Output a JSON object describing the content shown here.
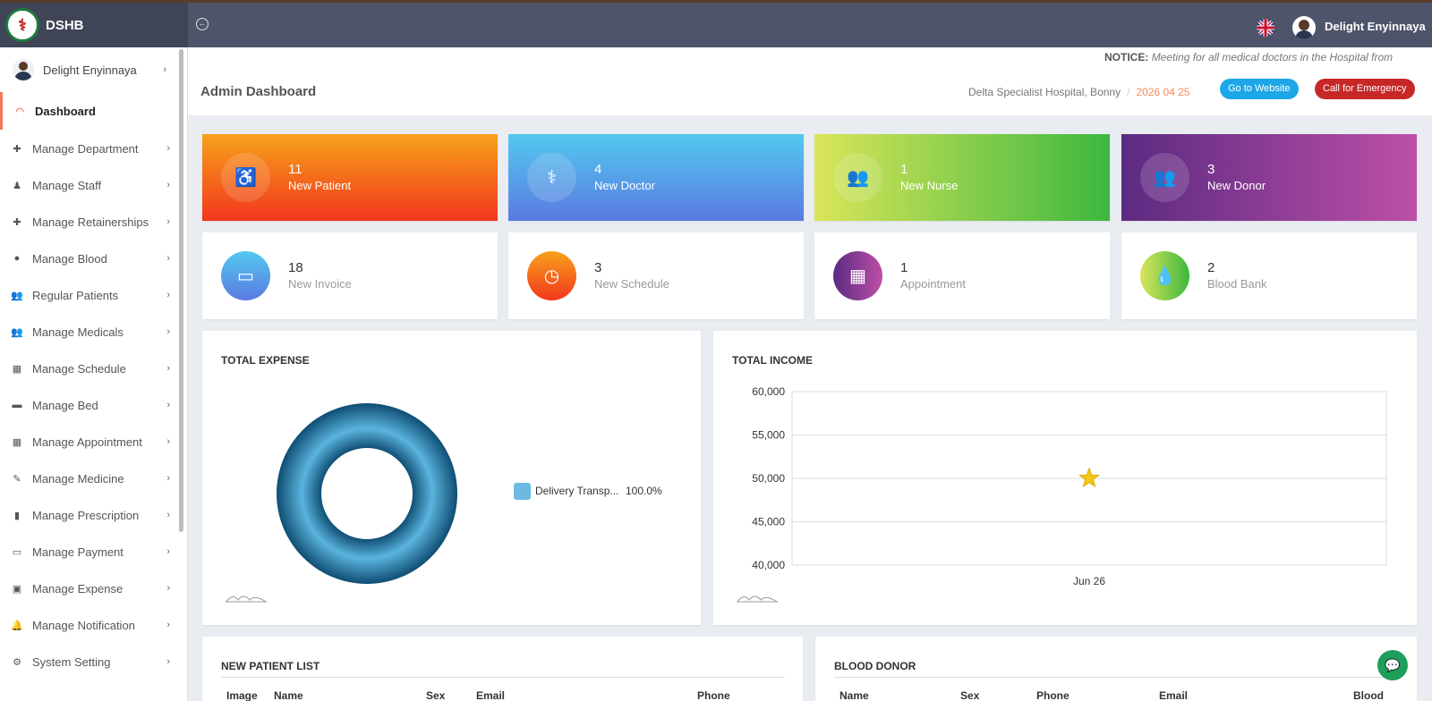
{
  "app": {
    "brand": "DSHB",
    "user_name": "Delight Enyinnaya"
  },
  "sidebar": {
    "user_name": "Delight Enyinnaya",
    "items": [
      {
        "label": "Dashboard",
        "icon": "dashboard-icon"
      },
      {
        "label": "Manage Department",
        "icon": "plus-icon"
      },
      {
        "label": "Manage Staff",
        "icon": "staff-icon"
      },
      {
        "label": "Manage Retainerships",
        "icon": "plus-icon"
      },
      {
        "label": "Manage Blood",
        "icon": "blood-drop-icon"
      },
      {
        "label": "Regular Patients",
        "icon": "users-icon"
      },
      {
        "label": "Manage Medicals",
        "icon": "users-icon"
      },
      {
        "label": "Manage Schedule",
        "icon": "calendar-icon"
      },
      {
        "label": "Manage Bed",
        "icon": "bed-icon"
      },
      {
        "label": "Manage Appointment",
        "icon": "calendar-icon"
      },
      {
        "label": "Manage Medicine",
        "icon": "edit-icon"
      },
      {
        "label": "Manage Prescription",
        "icon": "book-icon"
      },
      {
        "label": "Manage Payment",
        "icon": "credit-card-icon"
      },
      {
        "label": "Manage Expense",
        "icon": "money-icon"
      },
      {
        "label": "Manage Notification",
        "icon": "bell-icon"
      },
      {
        "label": "System Setting",
        "icon": "gears-icon"
      }
    ]
  },
  "header": {
    "notice_label": "NOTICE:",
    "notice_text": "Meeting for all medical doctors in the Hospital from",
    "title": "Admin Dashboard",
    "hospital": "Delta Specialist Hospital, Bonny",
    "date": "2026 04 25",
    "website_button": "Go to Website",
    "emergency_button": "Call for Emergency"
  },
  "stats": [
    {
      "value": "11",
      "label": "New Patient",
      "icon": "wheelchair-icon"
    },
    {
      "value": "4",
      "label": "New Doctor",
      "icon": "doctor-icon"
    },
    {
      "value": "1",
      "label": "New Nurse",
      "icon": "users-icon"
    },
    {
      "value": "3",
      "label": "New Donor",
      "icon": "users-icon"
    },
    {
      "value": "18",
      "label": "New Invoice",
      "icon": "credit-card-icon"
    },
    {
      "value": "3",
      "label": "New Schedule",
      "icon": "clock-icon"
    },
    {
      "value": "1",
      "label": "Appointment",
      "icon": "calendar-icon"
    },
    {
      "value": "2",
      "label": "Blood Bank",
      "icon": "blood-drop-icon"
    }
  ],
  "colors": {
    "patient": [
      "#f7a21b",
      "#f2361c"
    ],
    "doctor": [
      "#53c9ee",
      "#5b79e2"
    ],
    "nurse": [
      "#d9e55a",
      "#3db83f"
    ],
    "donor": [
      "#5b2a82",
      "#bd4fa7"
    ]
  },
  "panels": {
    "expense_title": "TOTAL EXPENSE",
    "income_title": "TOTAL INCOME",
    "patient_list_title": "NEW PATIENT LIST",
    "blood_donor_title": "BLOOD DONOR"
  },
  "tables": {
    "patient_headers": [
      "Image",
      "Name",
      "Sex",
      "Email",
      "Phone"
    ],
    "donor_headers": [
      "Name",
      "Sex",
      "Phone",
      "Email",
      "Blood"
    ]
  },
  "chart_data": [
    {
      "type": "pie",
      "title": "TOTAL EXPENSE",
      "donut": true,
      "labels": [
        "Delivery Transp..."
      ],
      "values": [
        100.0
      ],
      "value_labels": [
        "100.0%"
      ],
      "colors": [
        "#2c86b5"
      ],
      "legend": "right"
    },
    {
      "type": "scatter",
      "title": "TOTAL INCOME",
      "x": [
        "Jun 26"
      ],
      "y": [
        50000
      ],
      "ylim": [
        40000,
        60000
      ],
      "yticks": [
        "60,000",
        "55,000",
        "50,000",
        "45,000",
        "40,000"
      ],
      "ytick_values": [
        60000,
        55000,
        50000,
        45000,
        40000
      ],
      "marker": "star",
      "marker_color": "#f5c518",
      "grid": true
    }
  ]
}
